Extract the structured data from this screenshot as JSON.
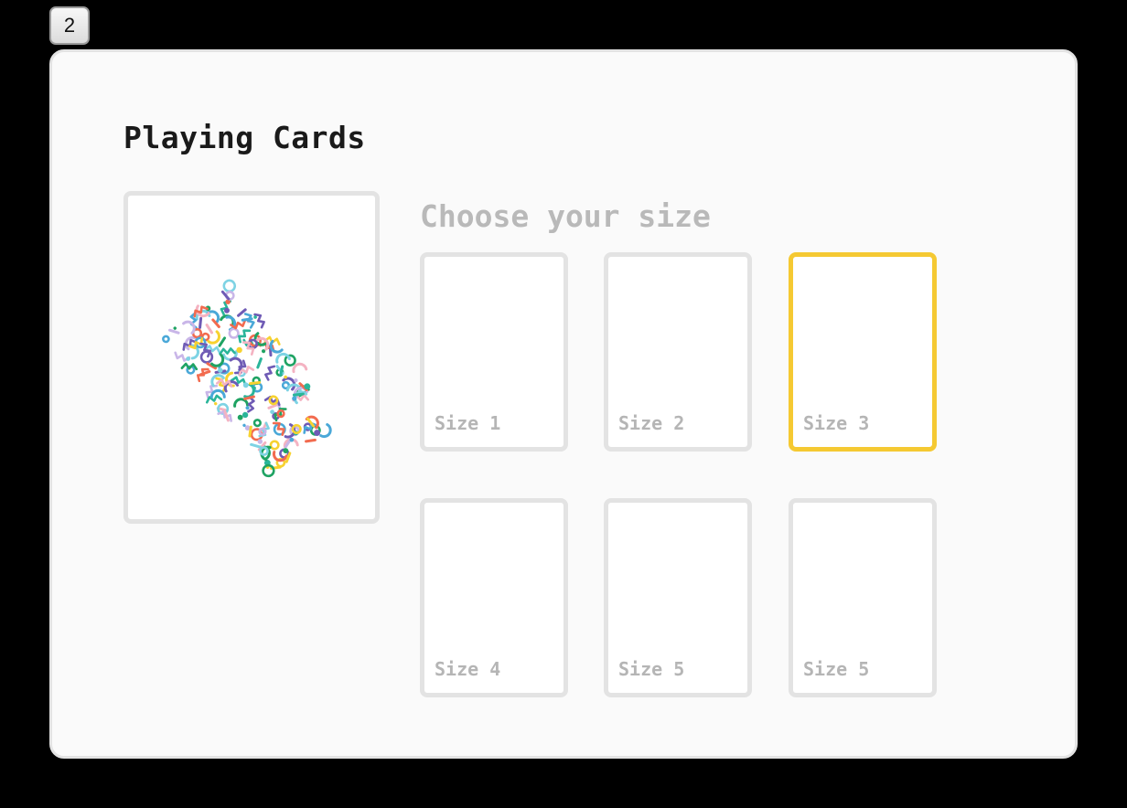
{
  "step_badge": "2",
  "title": "Playing Cards",
  "subtitle": "Choose your size",
  "selected_index": 2,
  "preview": {
    "pattern": "confetti-pattern",
    "colors": [
      "#6f5bb5",
      "#4aa8d8",
      "#7ed3e4",
      "#f26b4f",
      "#f7d230",
      "#1fa363",
      "#c9b6e8",
      "#f4b3c2",
      "#2ab59a"
    ]
  },
  "sizes": [
    {
      "label": "Size 1"
    },
    {
      "label": "Size 2"
    },
    {
      "label": "Size 3"
    },
    {
      "label": "Size 4"
    },
    {
      "label": "Size 5"
    },
    {
      "label": "Size 5"
    }
  ],
  "colors": {
    "selected_border": "#f5c932",
    "card_border": "#e3e3e3",
    "panel_background": "#fafafa"
  }
}
